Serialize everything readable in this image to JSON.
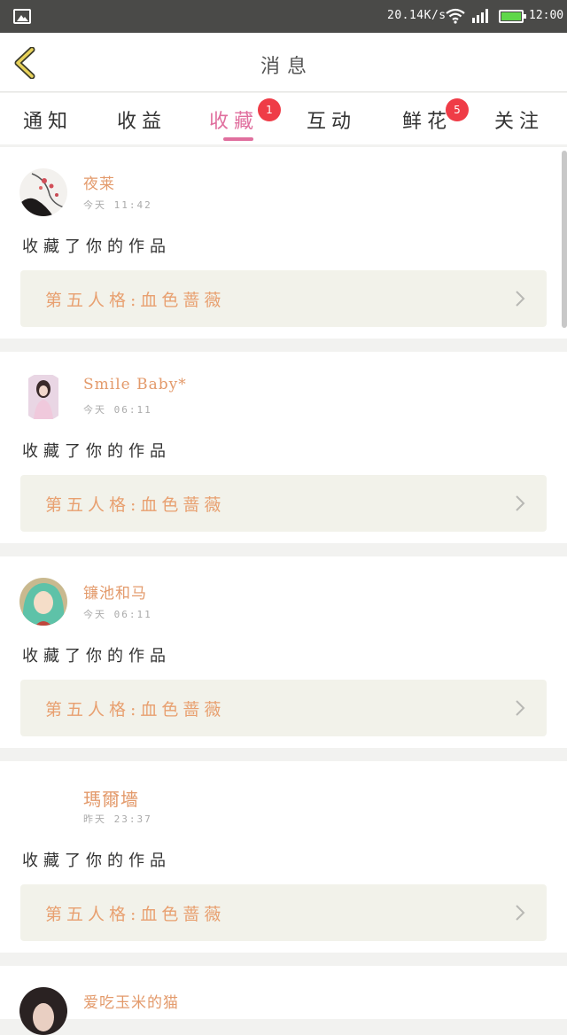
{
  "status_bar": {
    "network_speed": "20.14K/s",
    "time": "12:00",
    "icons": [
      "gallery-icon",
      "wifi-icon",
      "signal-icon",
      "battery-icon"
    ]
  },
  "header": {
    "title": "消息",
    "back_icon": "chevron-left-icon"
  },
  "tabs": [
    {
      "label": "通知",
      "badge": null
    },
    {
      "label": "收益",
      "badge": null
    },
    {
      "label": "收藏",
      "badge": "1",
      "active": true
    },
    {
      "label": "互动",
      "badge": null
    },
    {
      "label": "鲜花",
      "badge": "5"
    },
    {
      "label": "关注",
      "badge": null
    }
  ],
  "colors": {
    "accent": "#e06f9e",
    "username": "#e39a6b",
    "work_title": "#e8a070",
    "badge": "#ef3c47",
    "work_bg": "#f2f2ea"
  },
  "messages": [
    {
      "user": "夜莱",
      "time": "今天 11:42",
      "action": "收藏了你的作品",
      "work": "第五人格:血色蔷薇"
    },
    {
      "user": "Smile Baby*",
      "time": "今天 06:11",
      "action": "收藏了你的作品",
      "work": "第五人格:血色蔷薇"
    },
    {
      "user": "镰池和马",
      "time": "今天 06:11",
      "action": "收藏了你的作品",
      "work": "第五人格:血色蔷薇"
    },
    {
      "user": "瑪爾墻",
      "time": "昨天 23:37",
      "action": "收藏了你的作品",
      "work": "第五人格:血色蔷薇"
    },
    {
      "user": "爱吃玉米的猫",
      "time": "",
      "action": "",
      "work": ""
    }
  ]
}
